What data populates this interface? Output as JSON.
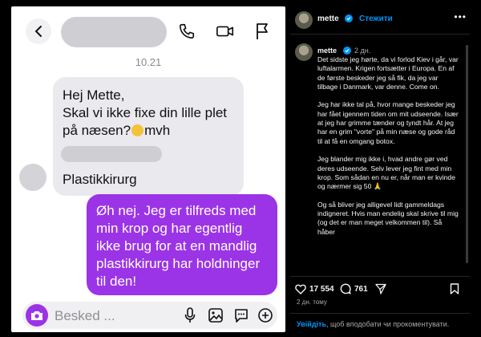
{
  "chat": {
    "timestamp": "10.21",
    "incoming_message": "Hej Mette,\nSkal vi ikke fixe din lille plet\npå næsen?",
    "incoming_suffix": "mvh",
    "incoming_signature": "Plastikkirurg",
    "outgoing_message": "Øh nej. Jeg er tilfreds med\nmin krop og har egentlig\nikke brug for at en mandlig\nplastikkirurg har holdninger\ntil den!",
    "composer_placeholder": "Besked ...",
    "accent_color": "#9b34e6"
  },
  "post": {
    "username": "mette",
    "follow_label": "Стежити",
    "more_label": "•••",
    "caption_time": "2 дн.",
    "caption": "Det sidste jeg hørte, da vi forlod Kiev i går, var luftalarmen. Krigen fortsætter i Europa. En af de første beskeder jeg så fik, da jeg var tilbage i Danmark, var denne. Come on.\n\nJeg har ikke tal på, hvor mange beskeder jeg har fået igennem tiden om mit udseende. Især at jeg har grimme tænder og tyndt hår. At jeg har en grim \"vorte\" på min næse og gode råd til at få en omgang botox.\n\nJeg blander mig ikke i, hvad andre gør ved deres udseende. Selv lever jeg fint med min krop. Som sådan en nu er, når man er kvinde og nærmer sig 50 🙏\n\nOg så bliver jeg alligevel lidt gammeldags indigneret. Hvis man endelig skal skrive til mig (og det er man meget velkommen til). Så håber",
    "likes": "17 554",
    "comments": "761",
    "post_time": "2 дн. тому",
    "login_link": "Увійдіть",
    "login_text": ", щоб вподобати чи прокоментувати.",
    "link_color": "#0095f6"
  }
}
